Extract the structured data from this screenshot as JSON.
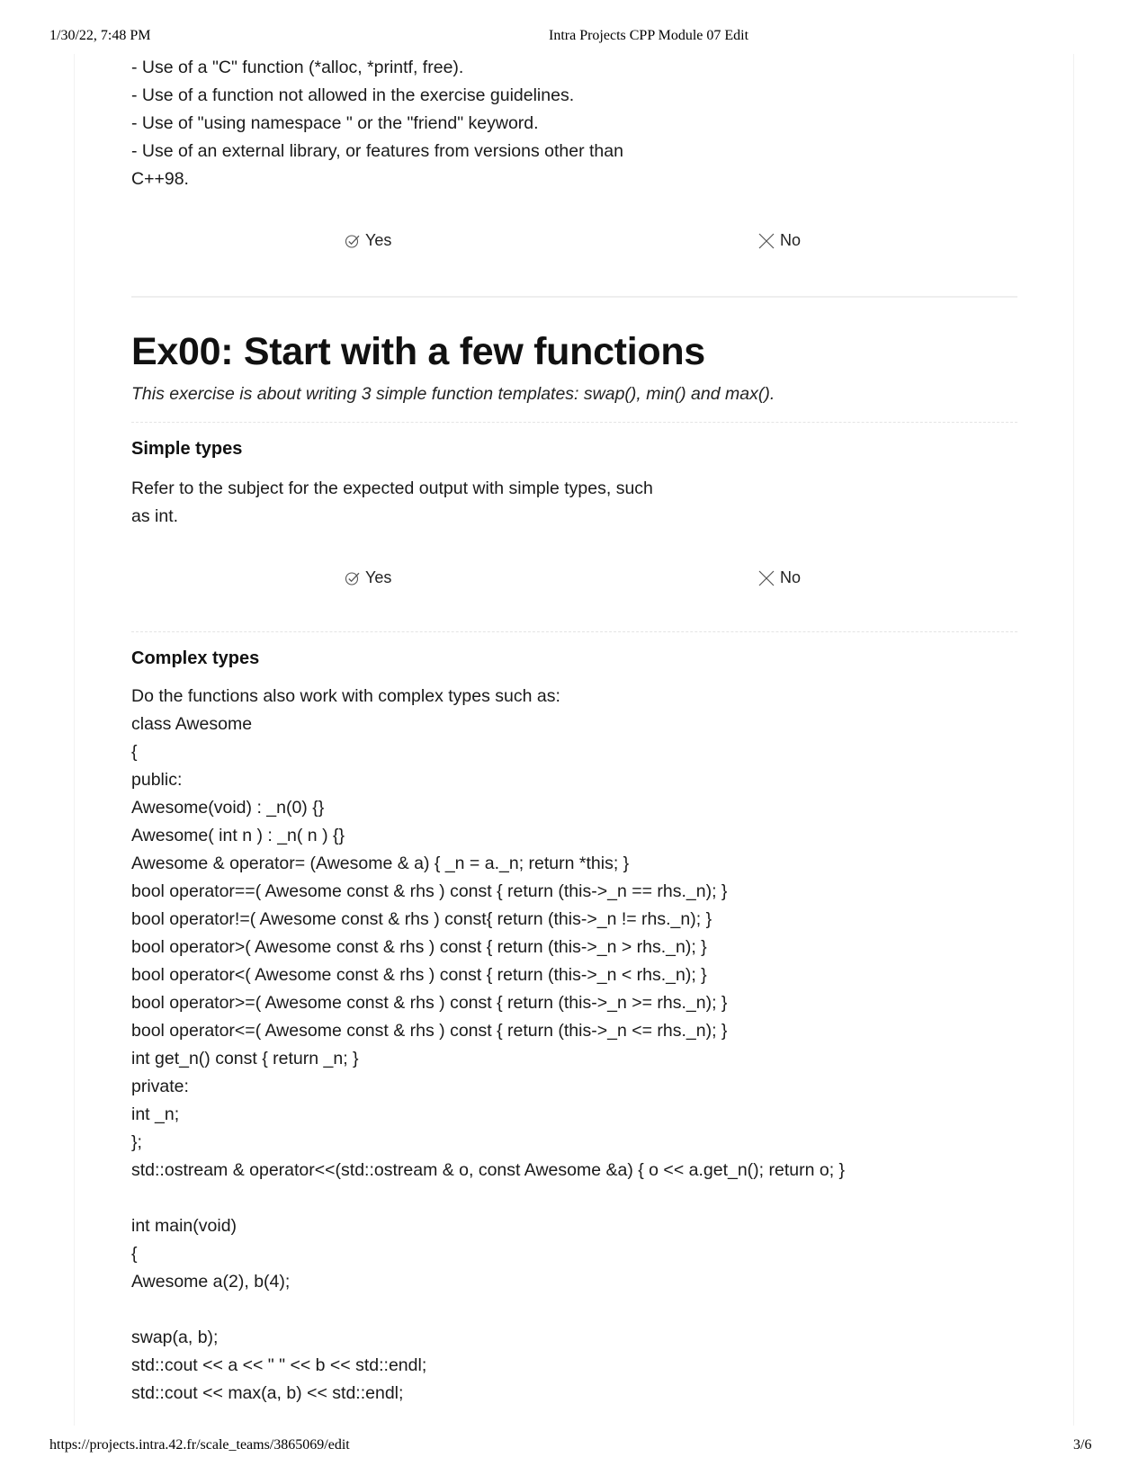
{
  "print_header": {
    "datetime": "1/30/22, 7:48 PM",
    "title": "Intra Projects CPP Module 07 Edit"
  },
  "print_footer": {
    "url": "https://projects.intra.42.fr/scale_teams/3865069/edit",
    "page": "3/6"
  },
  "intro": {
    "lines": [
      "- Use of a \"C\" function (*alloc, *printf, free).",
      "- Use of a function not allowed in the exercise guidelines.",
      "- Use of \"using namespace \" or the \"friend\" keyword.",
      "- Use of an external library, or features from versions other than",
      "C++98."
    ],
    "yes_label": "Yes",
    "no_label": "No"
  },
  "section": {
    "title": "Ex00: Start with a few functions",
    "description": "This exercise is about writing 3 simple function templates: swap(), min() and max()."
  },
  "simple_types": {
    "title": "Simple types",
    "lines": [
      "Refer to the subject for the expected output with simple types, such",
      "as int."
    ],
    "yes_label": "Yes",
    "no_label": "No"
  },
  "complex_types": {
    "title": "Complex types",
    "lines": [
      "Do the functions also work with complex types such as:",
      "class Awesome",
      "{",
      "public:",
      "Awesome(void) : _n(0) {}",
      "Awesome( int n ) : _n( n ) {}",
      "Awesome & operator= (Awesome & a) { _n = a._n; return *this; }",
      "bool operator==( Awesome const & rhs ) const { return (this->_n == rhs._n); }",
      "bool operator!=( Awesome const & rhs ) const{ return (this->_n != rhs._n); }",
      "bool operator>( Awesome const & rhs ) const { return (this->_n > rhs._n); }",
      "bool operator<( Awesome const & rhs ) const { return (this->_n < rhs._n); }",
      "bool operator>=( Awesome const & rhs ) const { return (this->_n >= rhs._n); }",
      "bool operator<=( Awesome const & rhs ) const { return (this->_n <= rhs._n); }",
      "int get_n() const { return _n; }",
      "private:",
      "int _n;",
      "};",
      "std::ostream & operator<<(std::ostream & o, const Awesome &a) { o << a.get_n(); return o; }",
      "",
      "int main(void)",
      "{",
      "Awesome a(2), b(4);",
      "",
      "swap(a, b);",
      "std::cout << a << \" \" << b << std::endl;",
      "std::cout << max(a, b) << std::endl;"
    ]
  }
}
